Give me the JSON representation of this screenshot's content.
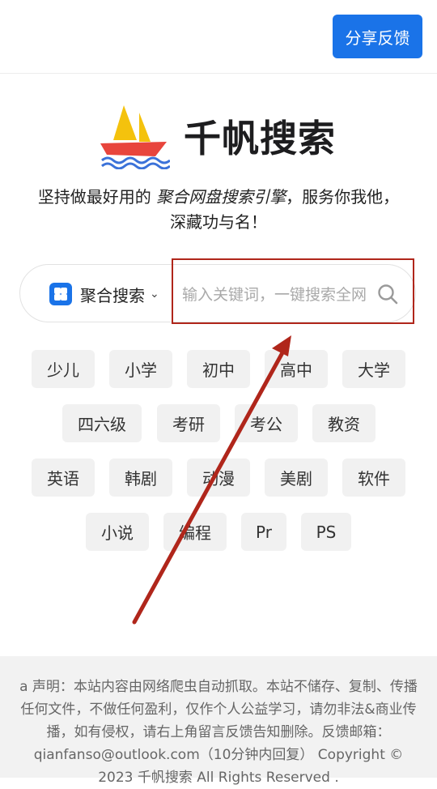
{
  "header": {
    "feedback_label": "分享反馈"
  },
  "brand": {
    "name": "千帆搜索"
  },
  "tagline": {
    "prefix": "坚持做最好用的 ",
    "emphasis": "聚合网盘搜索引擎",
    "suffix": "，服务你我他，深藏功与名！"
  },
  "search": {
    "mode_label": "聚合搜索",
    "placeholder": "输入关键词，一键搜索全网",
    "mode_icon": "grid-icon",
    "search_icon": "search-icon"
  },
  "tags": [
    "少儿",
    "小学",
    "初中",
    "高中",
    "大学",
    "四六级",
    "考研",
    "考公",
    "教资",
    "英语",
    "韩剧",
    "动漫",
    "美剧",
    "软件",
    "小说",
    "编程",
    "Pr",
    "PS"
  ],
  "footer": {
    "disclaimer": "a 声明：本站内容由网络爬虫自动抓取。本站不储存、复制、传播任何文件，不做任何盈利，仅作个人公益学习，请勿非法&商业传播，如有侵权，请右上角留言反馈告知删除。反馈邮箱：qianfanso@outlook.com（10分钟内回复） Copyright © 2023 千帆搜索 All Rights Reserved ."
  },
  "colors": {
    "accent": "#1a73e8",
    "annotation": "#b0261b",
    "tag_bg": "#f1f1f1",
    "footer_bg": "#f2f2f2"
  }
}
